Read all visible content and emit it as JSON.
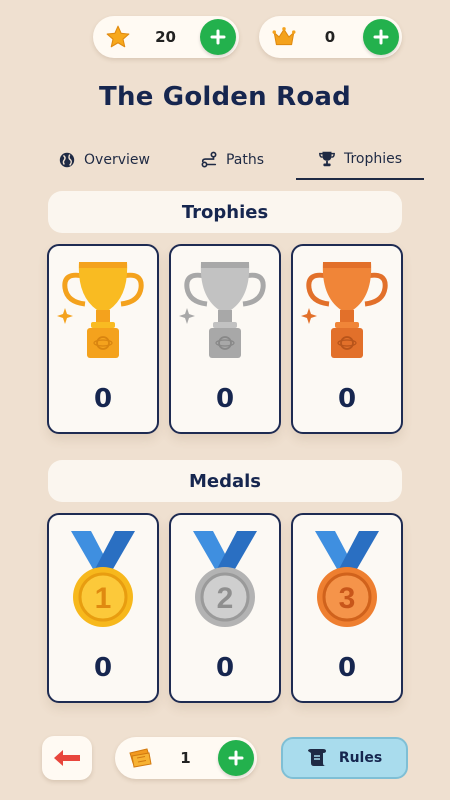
{
  "currency": {
    "stars": {
      "value": "20",
      "icon": "star-icon"
    },
    "crowns": {
      "value": "0",
      "icon": "crown-icon"
    }
  },
  "title": "The Golden Road",
  "tabs": [
    {
      "label": "Overview",
      "icon": "globe-icon",
      "active": false
    },
    {
      "label": "Paths",
      "icon": "path-icon",
      "active": false
    },
    {
      "label": "Trophies",
      "icon": "trophy-icon",
      "active": true
    }
  ],
  "trophies": {
    "heading": "Trophies",
    "items": [
      {
        "tier": "gold",
        "count": "0"
      },
      {
        "tier": "silver",
        "count": "0"
      },
      {
        "tier": "bronze",
        "count": "0"
      }
    ]
  },
  "medals": {
    "heading": "Medals",
    "items": [
      {
        "tier": "gold",
        "number": "1",
        "count": "0"
      },
      {
        "tier": "silver",
        "number": "2",
        "count": "0"
      },
      {
        "tier": "bronze",
        "number": "3",
        "count": "0"
      }
    ]
  },
  "footer": {
    "tickets": "1",
    "rules_label": "Rules"
  },
  "colors": {
    "background": "#efe0d0",
    "accent_green": "#23b14d",
    "navy": "#16264f",
    "rules_button": "#a9dced",
    "gold": "#f7b81c",
    "silver": "#b3b3b3",
    "bronze": "#ee7f30"
  }
}
